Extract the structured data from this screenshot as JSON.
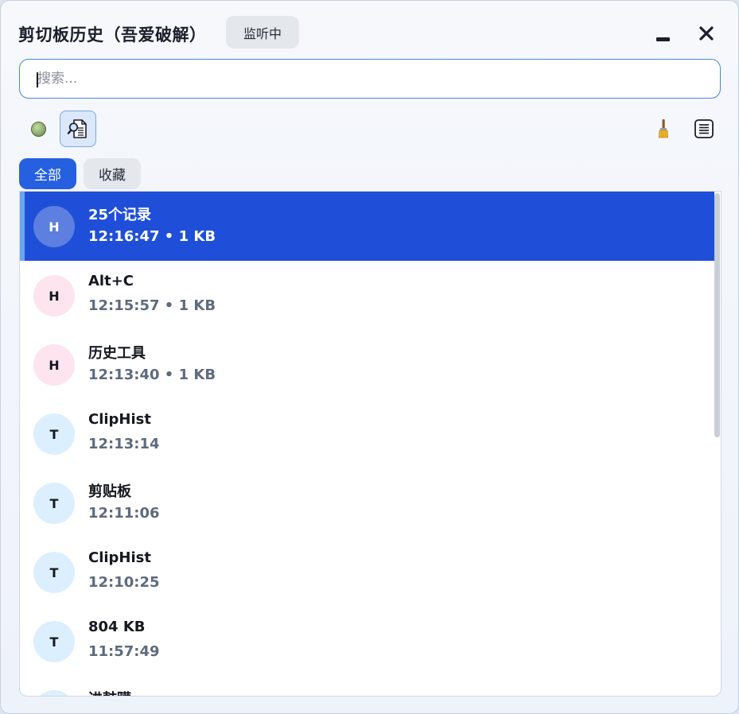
{
  "header": {
    "title": "剪切板历史（吾爱破解）",
    "status_label": "监听中",
    "minimize_icon": "minimize-icon",
    "close_icon": "close-icon"
  },
  "search": {
    "placeholder": "搜索...",
    "value": ""
  },
  "toolbar": {
    "status_dot_color": "#8fae71",
    "icons": [
      "status-dot-icon",
      "preview-search-icon",
      "brush-clean-icon",
      "list-view-icon"
    ]
  },
  "tabs": [
    {
      "label": "全部",
      "active": true
    },
    {
      "label": "收藏",
      "active": false
    }
  ],
  "items": [
    {
      "avatar": "H",
      "title": "25个记录",
      "meta": "12:16:47 • 1 KB",
      "selected": true
    },
    {
      "avatar": "H",
      "title": "Alt+C",
      "meta": "12:15:57 • 1 KB",
      "selected": false
    },
    {
      "avatar": "H",
      "title": "历史工具",
      "meta": "12:13:40 • 1 KB",
      "selected": false
    },
    {
      "avatar": "T",
      "title": "ClipHist",
      "meta": "12:13:14",
      "selected": false
    },
    {
      "avatar": "T",
      "title": "剪贴板",
      "meta": "12:11:06",
      "selected": false
    },
    {
      "avatar": "T",
      "title": "ClipHist",
      "meta": "12:10:25",
      "selected": false
    },
    {
      "avatar": "T",
      "title": "804 KB",
      "meta": "11:57:49",
      "selected": false
    },
    {
      "avatar": "T",
      "title": "进鼓躏",
      "meta": "",
      "selected": false
    }
  ],
  "colors": {
    "accent": "#2560e0",
    "selected_row": "#1f4fd8",
    "avatar_H": "#fde4ee",
    "avatar_T": "#dcefff"
  }
}
